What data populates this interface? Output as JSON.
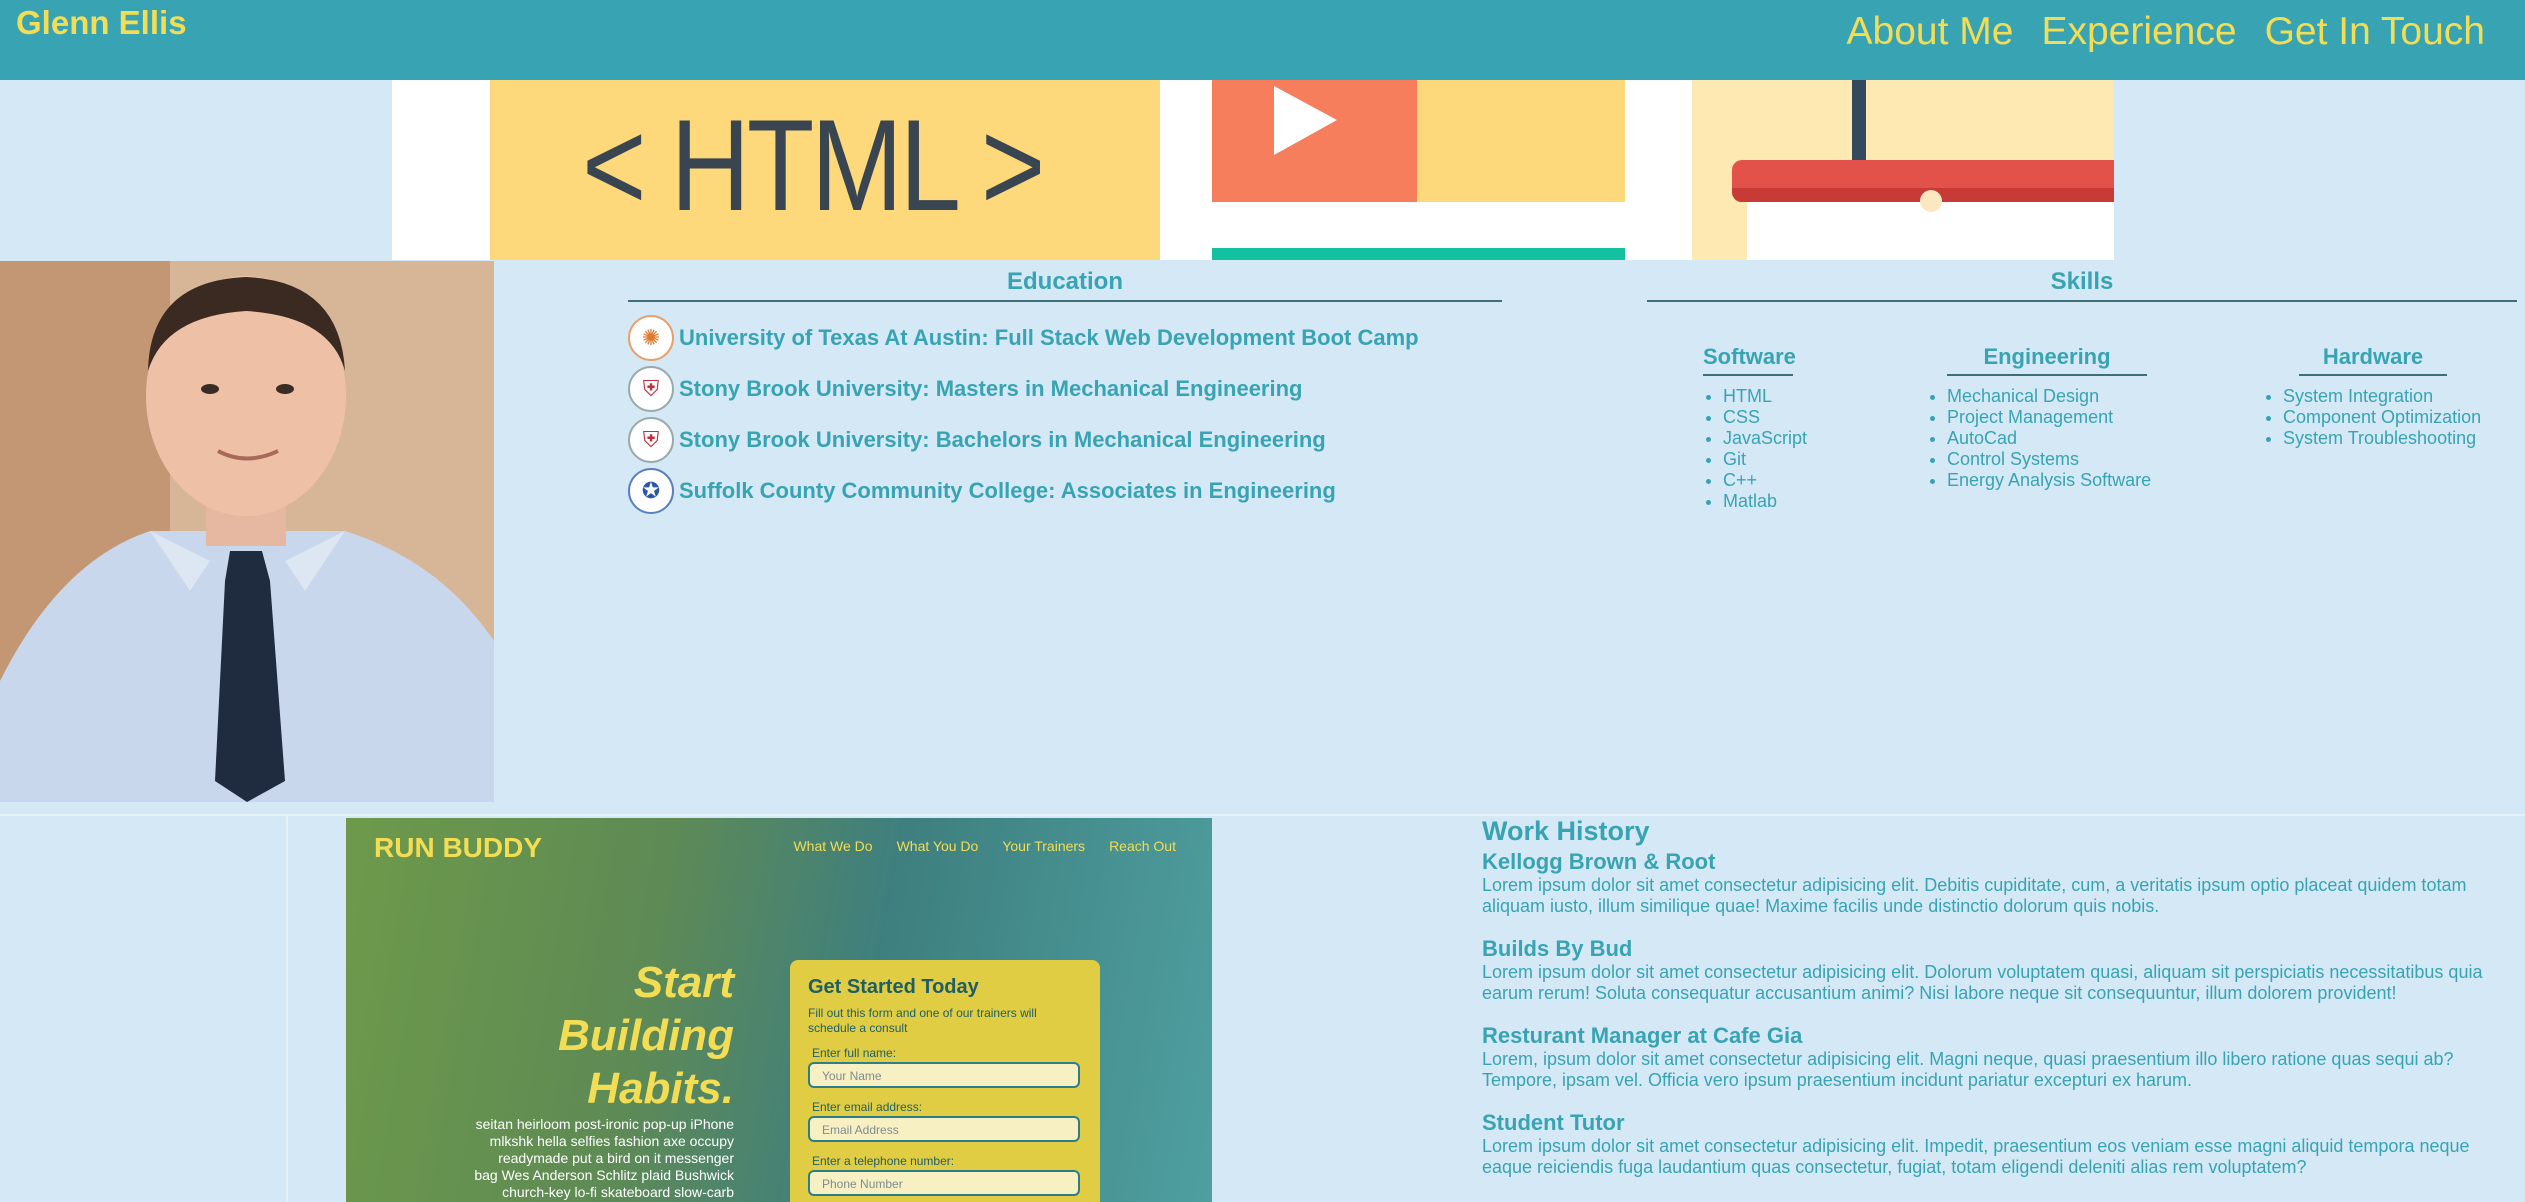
{
  "header": {
    "brand": "Glenn Ellis",
    "nav": [
      "About Me",
      "Experience",
      "Get In Touch"
    ]
  },
  "banner": {
    "html_text": "< HTML >"
  },
  "education": {
    "title": "Education",
    "items": [
      {
        "name": "University of Texas At Austin: Full Stack Web Development Boot Camp",
        "seal": "ut-austin-seal-icon"
      },
      {
        "name": "Stony Brook University: Masters in Mechanical Engineering",
        "seal": "stony-brook-seal-icon"
      },
      {
        "name": "Stony Brook University: Bachelors in Mechanical Engineering",
        "seal": "stony-brook-seal-icon"
      },
      {
        "name": "Suffolk County Community College: Associates in Engineering",
        "seal": "suffolk-seal-icon"
      }
    ]
  },
  "skills": {
    "title": "Skills",
    "columns": [
      {
        "title": "Software",
        "items": [
          "HTML",
          "CSS",
          "JavaScript",
          "Git",
          "C++",
          "Matlab"
        ]
      },
      {
        "title": "Engineering",
        "items": [
          "Mechanical Design",
          "Project Management",
          "AutoCad",
          "Control Systems",
          "Energy Analysis Software"
        ]
      },
      {
        "title": "Hardware",
        "items": [
          "System Integration",
          "Component Optimization",
          "System Troubleshooting"
        ]
      }
    ]
  },
  "project": {
    "title": "RUN BUDDY",
    "nav": [
      "What We Do",
      "What You Do",
      "Your Trainers",
      "Reach Out"
    ],
    "hero": [
      "Start",
      "Building",
      "Habits."
    ],
    "hero_text": [
      "seitan heirloom post-ironic pop-up iPhone",
      "mlkshk hella selfies fashion axe occupy",
      "readymade put a bird on it messenger",
      "bag Wes Anderson Schlitz plaid Bushwick",
      "church-key lo-fi skateboard slow-carb"
    ],
    "form": {
      "heading": "Get Started Today",
      "subtext": "Fill out this form and one of our trainers will schedule a consult",
      "fields": [
        {
          "label": "Enter full name:",
          "placeholder": "Your Name"
        },
        {
          "label": "Enter email address:",
          "placeholder": "Email Address"
        },
        {
          "label": "Enter a telephone number:",
          "placeholder": "Phone Number"
        }
      ]
    }
  },
  "work": {
    "title": "Work History",
    "jobs": [
      {
        "title": "Kellogg Brown & Root",
        "desc": "Lorem ipsum dolor sit amet consectetur adipisicing elit. Debitis cupiditate, cum, a veritatis ipsum optio placeat quidem totam aliquam iusto, illum similique quae! Maxime facilis unde distinctio dolorum quis nobis."
      },
      {
        "title": "Builds By Bud",
        "desc": "Lorem ipsum dolor sit amet consectetur adipisicing elit. Dolorum voluptatem quasi, aliquam sit perspiciatis necessitatibus quia earum rerum! Soluta consequatur accusantium animi? Nisi labore neque sit consequuntur, illum dolorem provident!"
      },
      {
        "title": "Resturant Manager at Cafe Gia",
        "desc": "Lorem, ipsum dolor sit amet consectetur adipisicing elit. Magni neque, quasi praesentium illo libero ratione quas sequi ab? Tempore, ipsam vel. Officia vero ipsum praesentium incidunt pariatur excepturi ex harum."
      },
      {
        "title": "Student Tutor",
        "desc": "Lorem ipsum dolor sit amet consectetur adipisicing elit. Impedit, praesentium eos veniam esse magni aliquid tempora neque eaque reiciendis fuga laudantium quas consectetur, fugiat, totam eligendi deleniti alias rem voluptatem?"
      }
    ]
  },
  "colors": {
    "header_bg": "#38a4b3",
    "accent_yellow": "#f3dd55",
    "page_bg": "#d4e8f5",
    "text_teal": "#38a4b3"
  }
}
